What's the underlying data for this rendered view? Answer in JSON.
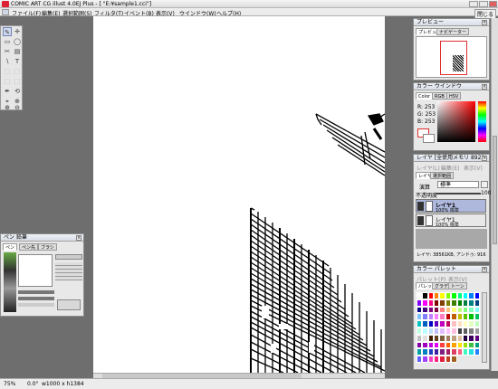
{
  "window": {
    "title": "COMIC ART CG illust 4.0EJ Plus - [ \"E:¥sample1.cci\"]",
    "doc_close_label": "閉じる"
  },
  "menu": [
    "ファイル(F)",
    "編集(E)",
    "選択範囲(S)",
    "フィルタ(T)",
    "イベント(B)",
    "表示(V)",
    "ウインドウ(W)",
    "ヘルプ(H)"
  ],
  "tools": [
    "✎",
    "✛",
    "▭",
    "◯",
    "✂",
    "▤",
    "∖",
    "T",
    "⬚",
    "⬚",
    "⬚",
    "⬚",
    "✒",
    "⟲",
    "⌖",
    "⊕",
    "⊕",
    "⊖"
  ],
  "pen_panel": {
    "title": "ペン 鉛筆",
    "tabs": [
      "ペン",
      "ペン先",
      "ブラシ"
    ]
  },
  "preview_panel": {
    "title": "プレビュー",
    "tabs": [
      "プレビュー",
      "ナビゲーター"
    ]
  },
  "color_panel": {
    "title": "カラー ウインドウ",
    "tabs": [
      "Color",
      "RGB",
      "HSV"
    ],
    "r": "R: 253",
    "g": "G: 253",
    "b": "B: 253",
    "selected_color": "#fdfdfd",
    "hue_color": "#ff0000"
  },
  "layer_panel": {
    "title": "レイヤ [全使用メモリ 8921",
    "menu": [
      "レイヤ(L)",
      "編集(E)",
      "表示(V)"
    ],
    "tabs": [
      "レイヤ",
      "選択範囲"
    ],
    "blend_label": "演算",
    "blend_value": "標準",
    "opacity_label": "不透明度",
    "opacity_value": "100",
    "layers": [
      {
        "name": "レイヤ1",
        "info": "100% 標準"
      },
      {
        "name": "レイヤ1",
        "info": "100% 標準"
      }
    ],
    "footer": "レイヤ: 38561KB, アンドゥ: 916"
  },
  "palette_panel": {
    "title": "カラー パレット",
    "menu": [
      "パレット(P)",
      "表示(V)"
    ],
    "tabs": [
      "パレット",
      "グラデ",
      "トーン"
    ],
    "colors": [
      "#ffffff",
      "#000000",
      "#ff0000",
      "#ff8000",
      "#ffff00",
      "#80ff00",
      "#00ff00",
      "#00ff80",
      "#00ffff",
      "#0080ff",
      "#0000ff",
      "#8000ff",
      "#ff00ff",
      "#ff0080",
      "#800000",
      "#804000",
      "#808000",
      "#408000",
      "#008000",
      "#008040",
      "#008080",
      "#004080",
      "#000080",
      "#400080",
      "#800080",
      "#800040",
      "#ff8080",
      "#ffc080",
      "#ffff80",
      "#c0ff80",
      "#80ff80",
      "#80ffc0",
      "#80ffff",
      "#80c0ff",
      "#8080ff",
      "#c080ff",
      "#ff80ff",
      "#ff80c0",
      "#c00000",
      "#c06000",
      "#c0c000",
      "#60c000",
      "#00c000",
      "#00c060",
      "#00c0c0",
      "#0060c0",
      "#0000c0",
      "#6000c0",
      "#c000c0",
      "#c00060",
      "#ffc0c0",
      "#ffe0c0",
      "#ffffc0",
      "#e0ffc0",
      "#c0ffc0",
      "#c0ffe0",
      "#c0ffff",
      "#c0e0ff",
      "#c0c0ff",
      "#e0c0ff",
      "#ffc0ff",
      "#ffc0e0",
      "#404040",
      "#606060",
      "#808080",
      "#a0a0a0",
      "#c0c0c0",
      "#e0e0e0",
      "#402000",
      "#604020",
      "#806040",
      "#a08060",
      "#c0a080",
      "#e0c0a0",
      "#200040",
      "#400060",
      "#600080",
      "#8000a0",
      "#a000c0",
      "#c000e0",
      "#e000ff",
      "#ff4040",
      "#ff6000",
      "#ffa000",
      "#ffe000",
      "#a0e000",
      "#40c040",
      "#00a080",
      "#00a0a0",
      "#0080c0",
      "#2040c0",
      "#4020a0",
      "#802080",
      "#a02060",
      "#e04060",
      "#ff6080",
      "#40ffc0",
      "#20e0e0",
      "#2080ff",
      "#6060ff",
      "#a040ff",
      "#ff40c0",
      "#ff2080",
      "#e02040",
      "#c04020",
      "#a06020"
    ]
  },
  "status": {
    "zoom": "75%",
    "angle": "0.0°",
    "size": "w1000 x h1384"
  }
}
